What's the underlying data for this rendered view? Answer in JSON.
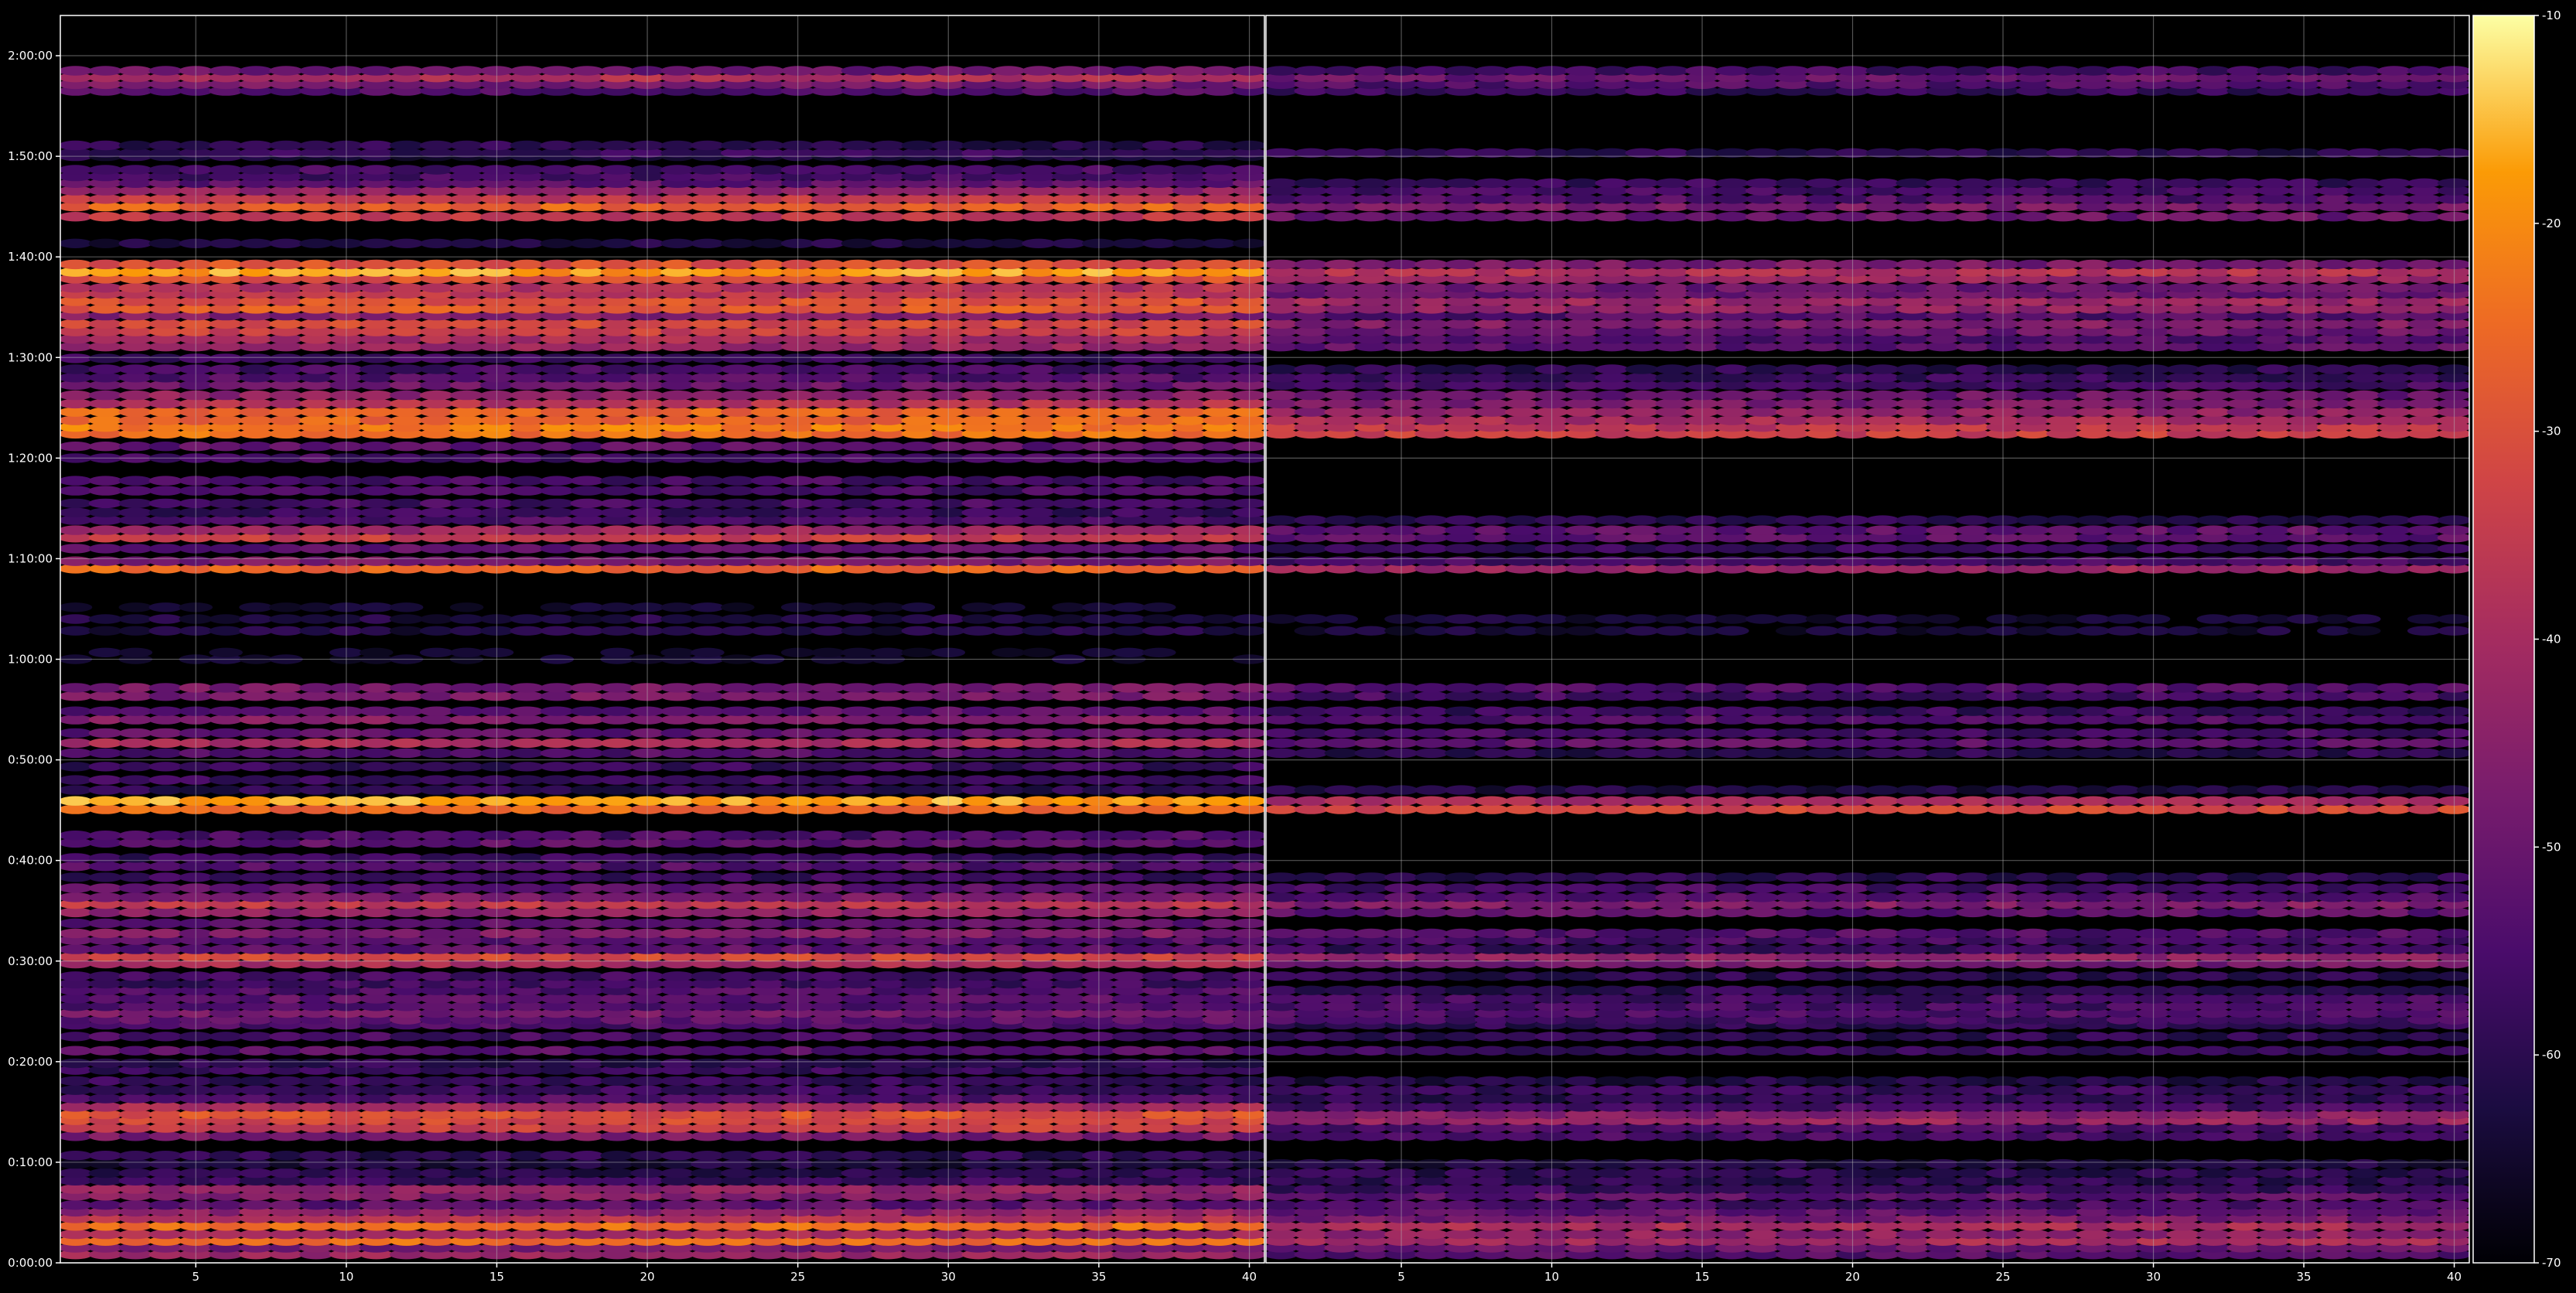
{
  "chart_data": {
    "type": "heatmap",
    "title": "",
    "xlabel": "",
    "ylabel": "",
    "grid": true,
    "colormap": "inferno",
    "background": "#000000",
    "y_range_seconds": [
      0,
      7440
    ],
    "y_ticks": [
      "0:00:00",
      "0:10:00",
      "0:20:00",
      "0:30:00",
      "0:40:00",
      "0:50:00",
      "1:00:00",
      "1:10:00",
      "1:20:00",
      "1:30:00",
      "1:40:00",
      "1:50:00",
      "2:00:00"
    ],
    "colorbar": {
      "range": [
        -70,
        -10
      ],
      "ticks": [
        "-10",
        "-20",
        "-30",
        "-40",
        "-50",
        "-60",
        "-70"
      ]
    },
    "panels": [
      {
        "name": "",
        "x_range": [
          1,
          40
        ],
        "x_ticks": [
          "5",
          "10",
          "15",
          "20",
          "25",
          "30",
          "35",
          "40"
        ],
        "bands": [
          {
            "t": 50,
            "v": -42
          },
          {
            "t": 90,
            "v": -48
          },
          {
            "t": 130,
            "v": -25
          },
          {
            "t": 170,
            "v": -40
          },
          {
            "t": 220,
            "v": -24
          },
          {
            "t": 265,
            "v": -38
          },
          {
            "t": 305,
            "v": -44
          },
          {
            "t": 345,
            "v": -52
          },
          {
            "t": 400,
            "v": -46
          },
          {
            "t": 440,
            "v": -44
          },
          {
            "t": 490,
            "v": -58
          },
          {
            "t": 535,
            "v": -60
          },
          {
            "t": 590,
            "v": -62
          },
          {
            "t": 640,
            "v": -60
          },
          {
            "t": 755,
            "v": -48
          },
          {
            "t": 805,
            "v": -34
          },
          {
            "t": 850,
            "v": -32
          },
          {
            "t": 885,
            "v": -30
          },
          {
            "t": 930,
            "v": -40
          },
          {
            "t": 980,
            "v": -54
          },
          {
            "t": 1030,
            "v": -58
          },
          {
            "t": 1085,
            "v": -58
          },
          {
            "t": 1150,
            "v": -58
          },
          {
            "t": 1190,
            "v": -60
          },
          {
            "t": 1265,
            "v": -53
          },
          {
            "t": 1350,
            "v": -56
          },
          {
            "t": 1420,
            "v": -55
          },
          {
            "t": 1450,
            "v": -52
          },
          {
            "t": 1490,
            "v": -48
          },
          {
            "t": 1530,
            "v": -54
          },
          {
            "t": 1575,
            "v": -52
          },
          {
            "t": 1625,
            "v": -54
          },
          {
            "t": 1665,
            "v": -57
          },
          {
            "t": 1710,
            "v": -56
          },
          {
            "t": 1785,
            "v": -40
          },
          {
            "t": 1825,
            "v": -32
          },
          {
            "t": 1870,
            "v": -52
          },
          {
            "t": 1925,
            "v": -53
          },
          {
            "t": 1965,
            "v": -47
          },
          {
            "t": 2025,
            "v": -52
          },
          {
            "t": 2090,
            "v": -44
          },
          {
            "t": 2140,
            "v": -36
          },
          {
            "t": 2180,
            "v": -48
          },
          {
            "t": 2235,
            "v": -52
          },
          {
            "t": 2300,
            "v": -58
          },
          {
            "t": 2365,
            "v": -54
          },
          {
            "t": 2415,
            "v": -58
          },
          {
            "t": 2505,
            "v": -52
          },
          {
            "t": 2550,
            "v": -55
          },
          {
            "t": 2705,
            "v": -26
          },
          {
            "t": 2755,
            "v": -17
          },
          {
            "t": 2820,
            "v": -60
          },
          {
            "t": 2880,
            "v": -57
          },
          {
            "t": 2960,
            "v": -58
          },
          {
            "t": 3040,
            "v": -54
          },
          {
            "t": 3100,
            "v": -40
          },
          {
            "t": 3160,
            "v": -52
          },
          {
            "t": 3240,
            "v": -46
          },
          {
            "t": 3290,
            "v": -53
          },
          {
            "t": 3380,
            "v": -48
          },
          {
            "t": 3430,
            "v": -48
          },
          {
            "t": 3600,
            "v": -66
          },
          {
            "t": 3640,
            "v": -66
          },
          {
            "t": 3770,
            "v": -62
          },
          {
            "t": 3840,
            "v": -62
          },
          {
            "t": 3910,
            "v": -66
          },
          {
            "t": 4140,
            "v": -26
          },
          {
            "t": 4185,
            "v": -48
          },
          {
            "t": 4260,
            "v": -52
          },
          {
            "t": 4325,
            "v": -34
          },
          {
            "t": 4370,
            "v": -42
          },
          {
            "t": 4430,
            "v": -55
          },
          {
            "t": 4475,
            "v": -58
          },
          {
            "t": 4530,
            "v": -56
          },
          {
            "t": 4605,
            "v": -56
          },
          {
            "t": 4665,
            "v": -56
          },
          {
            "t": 4800,
            "v": -56
          },
          {
            "t": 4870,
            "v": -52
          },
          {
            "t": 4945,
            "v": -24
          },
          {
            "t": 4985,
            "v": -22
          },
          {
            "t": 5025,
            "v": -26
          },
          {
            "t": 5075,
            "v": -26
          },
          {
            "t": 5125,
            "v": -38
          },
          {
            "t": 5175,
            "v": -44
          },
          {
            "t": 5235,
            "v": -50
          },
          {
            "t": 5280,
            "v": -54
          },
          {
            "t": 5330,
            "v": -56
          },
          {
            "t": 5395,
            "v": -58
          },
          {
            "t": 5465,
            "v": -42
          },
          {
            "t": 5510,
            "v": -40
          },
          {
            "t": 5555,
            "v": -34
          },
          {
            "t": 5600,
            "v": -32
          },
          {
            "t": 5650,
            "v": -46
          },
          {
            "t": 5690,
            "v": -28
          },
          {
            "t": 5735,
            "v": -30
          },
          {
            "t": 5780,
            "v": -36
          },
          {
            "t": 5815,
            "v": -38
          },
          {
            "t": 5870,
            "v": -30
          },
          {
            "t": 5910,
            "v": -18
          },
          {
            "t": 5955,
            "v": -30
          },
          {
            "t": 6080,
            "v": -62
          },
          {
            "t": 6240,
            "v": -36
          },
          {
            "t": 6300,
            "v": -26
          },
          {
            "t": 6345,
            "v": -36
          },
          {
            "t": 6395,
            "v": -44
          },
          {
            "t": 6440,
            "v": -52
          },
          {
            "t": 6480,
            "v": -56
          },
          {
            "t": 6520,
            "v": -56
          },
          {
            "t": 6600,
            "v": -62
          },
          {
            "t": 6620,
            "v": -58
          },
          {
            "t": 6665,
            "v": -60
          },
          {
            "t": 6990,
            "v": -54
          },
          {
            "t": 7030,
            "v": -48
          },
          {
            "t": 7070,
            "v": -38
          },
          {
            "t": 7110,
            "v": -50
          }
        ]
      },
      {
        "name": "",
        "x_range": [
          1,
          40
        ],
        "x_ticks": [
          "5",
          "10",
          "15",
          "20",
          "25",
          "30",
          "35",
          "40"
        ],
        "bands": [
          {
            "t": 50,
            "v": -54
          },
          {
            "t": 90,
            "v": -50
          },
          {
            "t": 130,
            "v": -40
          },
          {
            "t": 170,
            "v": -44
          },
          {
            "t": 220,
            "v": -40
          },
          {
            "t": 265,
            "v": -48
          },
          {
            "t": 305,
            "v": -52
          },
          {
            "t": 345,
            "v": -56
          },
          {
            "t": 400,
            "v": -52
          },
          {
            "t": 440,
            "v": -58
          },
          {
            "t": 490,
            "v": -60
          },
          {
            "t": 535,
            "v": -60
          },
          {
            "t": 590,
            "v": -62
          },
          {
            "t": 755,
            "v": -56
          },
          {
            "t": 805,
            "v": -54
          },
          {
            "t": 850,
            "v": -42
          },
          {
            "t": 885,
            "v": -46
          },
          {
            "t": 930,
            "v": -56
          },
          {
            "t": 980,
            "v": -60
          },
          {
            "t": 1030,
            "v": -58
          },
          {
            "t": 1085,
            "v": -62
          },
          {
            "t": 1265,
            "v": -58
          },
          {
            "t": 1350,
            "v": -60
          },
          {
            "t": 1420,
            "v": -60
          },
          {
            "t": 1450,
            "v": -56
          },
          {
            "t": 1490,
            "v": -54
          },
          {
            "t": 1530,
            "v": -56
          },
          {
            "t": 1575,
            "v": -56
          },
          {
            "t": 1625,
            "v": -60
          },
          {
            "t": 1710,
            "v": -60
          },
          {
            "t": 1785,
            "v": -48
          },
          {
            "t": 1825,
            "v": -44
          },
          {
            "t": 1870,
            "v": -58
          },
          {
            "t": 1925,
            "v": -56
          },
          {
            "t": 1965,
            "v": -54
          },
          {
            "t": 2090,
            "v": -52
          },
          {
            "t": 2140,
            "v": -46
          },
          {
            "t": 2180,
            "v": -54
          },
          {
            "t": 2235,
            "v": -56
          },
          {
            "t": 2300,
            "v": -60
          },
          {
            "t": 2705,
            "v": -32
          },
          {
            "t": 2755,
            "v": -40
          },
          {
            "t": 2820,
            "v": -62
          },
          {
            "t": 3040,
            "v": -60
          },
          {
            "t": 3100,
            "v": -52
          },
          {
            "t": 3160,
            "v": -56
          },
          {
            "t": 3240,
            "v": -54
          },
          {
            "t": 3290,
            "v": -58
          },
          {
            "t": 3380,
            "v": -56
          },
          {
            "t": 3430,
            "v": -54
          },
          {
            "t": 3770,
            "v": -64
          },
          {
            "t": 3840,
            "v": -64
          },
          {
            "t": 4140,
            "v": -42
          },
          {
            "t": 4185,
            "v": -56
          },
          {
            "t": 4260,
            "v": -58
          },
          {
            "t": 4325,
            "v": -52
          },
          {
            "t": 4370,
            "v": -52
          },
          {
            "t": 4430,
            "v": -60
          },
          {
            "t": 4945,
            "v": -34
          },
          {
            "t": 4985,
            "v": -36
          },
          {
            "t": 5025,
            "v": -40
          },
          {
            "t": 5075,
            "v": -44
          },
          {
            "t": 5125,
            "v": -48
          },
          {
            "t": 5175,
            "v": -50
          },
          {
            "t": 5235,
            "v": -56
          },
          {
            "t": 5280,
            "v": -58
          },
          {
            "t": 5330,
            "v": -60
          },
          {
            "t": 5465,
            "v": -52
          },
          {
            "t": 5510,
            "v": -54
          },
          {
            "t": 5555,
            "v": -50
          },
          {
            "t": 5600,
            "v": -46
          },
          {
            "t": 5650,
            "v": -54
          },
          {
            "t": 5690,
            "v": -44
          },
          {
            "t": 5735,
            "v": -42
          },
          {
            "t": 5780,
            "v": -50
          },
          {
            "t": 5815,
            "v": -50
          },
          {
            "t": 5870,
            "v": -42
          },
          {
            "t": 5910,
            "v": -38
          },
          {
            "t": 5955,
            "v": -48
          },
          {
            "t": 6240,
            "v": -50
          },
          {
            "t": 6300,
            "v": -48
          },
          {
            "t": 6345,
            "v": -54
          },
          {
            "t": 6395,
            "v": -56
          },
          {
            "t": 6440,
            "v": -58
          },
          {
            "t": 6620,
            "v": -60
          },
          {
            "t": 6990,
            "v": -58
          },
          {
            "t": 7030,
            "v": -54
          },
          {
            "t": 7070,
            "v": -50
          },
          {
            "t": 7110,
            "v": -56
          }
        ]
      }
    ]
  }
}
